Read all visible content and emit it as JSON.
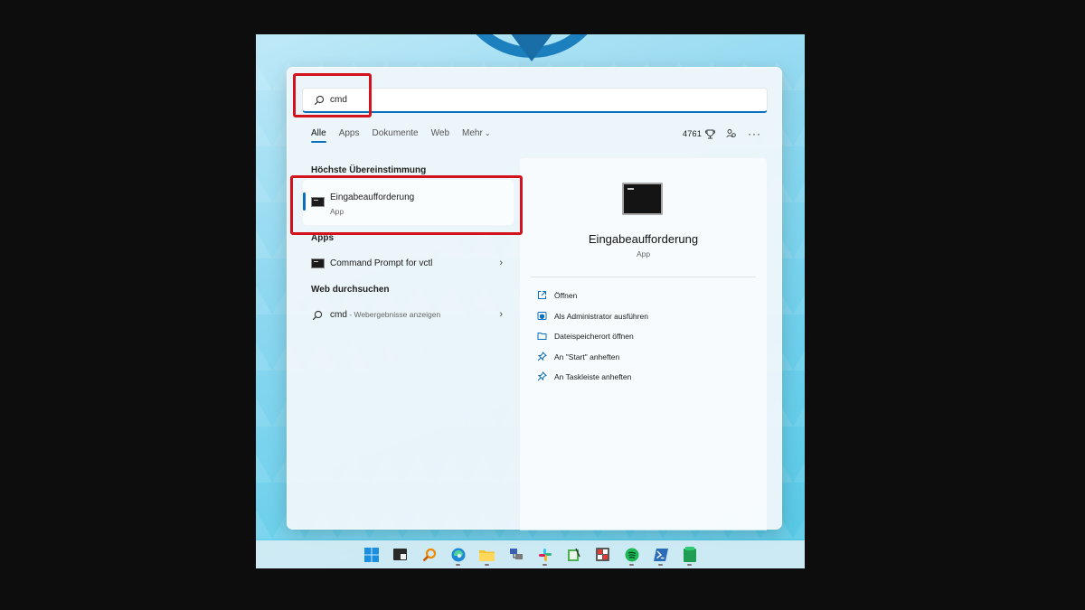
{
  "search": {
    "query": "cmd",
    "placeholder": ""
  },
  "tabs": [
    {
      "label": "Alle",
      "active": true
    },
    {
      "label": "Apps"
    },
    {
      "label": "Dokumente"
    },
    {
      "label": "Web"
    },
    {
      "label": "Mehr"
    }
  ],
  "toolbar": {
    "points": "4761",
    "icons": [
      "trophy-icon",
      "account-icon",
      "more-icon"
    ]
  },
  "best_match": {
    "section_title": "Höchste Übereinstimmung",
    "title": "Eingabeaufforderung",
    "subtitle": "App"
  },
  "apps": {
    "section_title": "Apps",
    "items": [
      {
        "label": "Command Prompt for vctl"
      }
    ]
  },
  "web": {
    "section_title": "Web durchsuchen",
    "query": "cmd",
    "suffix": " - Webergebnisse anzeigen"
  },
  "detail": {
    "title": "Eingabeaufforderung",
    "subtitle": "App",
    "actions": [
      {
        "label": "Öffnen",
        "icon": "open-icon"
      },
      {
        "label": "Als Administrator ausführen",
        "icon": "shield-icon"
      },
      {
        "label": "Dateispeicherort öffnen",
        "icon": "folder-icon"
      },
      {
        "label": "An \"Start\" anheften",
        "icon": "pin-icon"
      },
      {
        "label": "An Taskleiste anheften",
        "icon": "pin-icon"
      }
    ]
  },
  "colors": {
    "accent": "#0a6fbd",
    "highlight": "#d2131d"
  },
  "taskbar": [
    "windows-start-icon",
    "terminal-icon",
    "search-icon",
    "edge-icon",
    "file-explorer-icon",
    "network-icon",
    "slack-icon",
    "notepad-icon",
    "calculator-icon",
    "spotify-icon",
    "powershell-icon",
    "green-app-icon"
  ]
}
